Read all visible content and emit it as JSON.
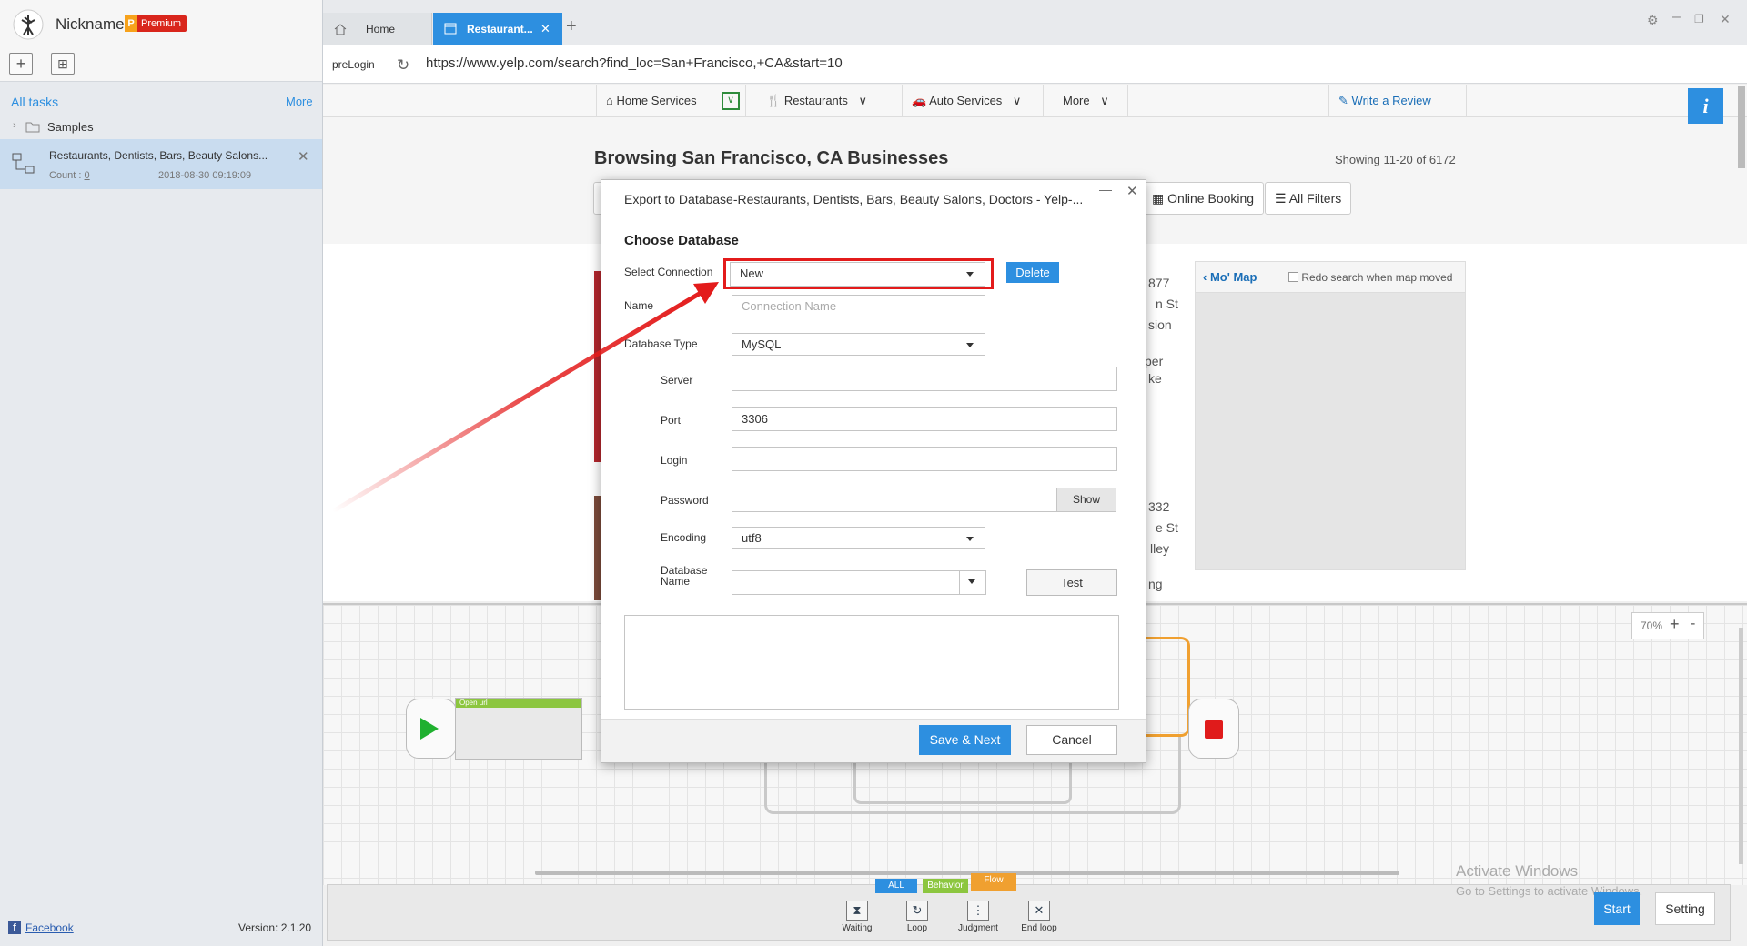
{
  "app": {
    "nickname": "Nickname",
    "premium": "Premium",
    "version": "Version: 2.1.20",
    "facebook": "Facebook"
  },
  "sidebar": {
    "all_tasks": "All tasks",
    "more": "More",
    "samples": "Samples",
    "task": {
      "name": "Restaurants, Dentists, Bars, Beauty Salons...",
      "count_label": "Count :",
      "count": "0",
      "date": "2018-08-30 09:19:09"
    }
  },
  "tabs": [
    {
      "label": "Home"
    },
    {
      "label": "Restaurant..."
    }
  ],
  "browser": {
    "prelogin": "preLogin",
    "url": "https://www.yelp.com/search?find_loc=San+Francisco,+CA&start=10"
  },
  "yelp": {
    "nav": [
      "Home Services",
      "Restaurants",
      "Auto Services",
      "More"
    ],
    "write_review": "Write a Review",
    "heading": "Browsing San Francisco, CA Businesses",
    "showing": "Showing 11-20 of 6172",
    "filters": [
      "Online Booking",
      "All Filters"
    ],
    "map_title": "Mo' Map",
    "redo": "Redo search when map moved",
    "peek": [
      "877",
      "n St",
      "sion",
      "per",
      "ke",
      "332",
      "e St",
      "lley",
      "ng"
    ]
  },
  "modal": {
    "title": "Export to Database-Restaurants, Dentists, Bars, Beauty Salons, Doctors - Yelp-...",
    "heading": "Choose Database",
    "select_connection_label": "Select Connection",
    "select_connection_value": "New",
    "delete": "Delete",
    "name_label": "Name",
    "name_placeholder": "Connection Name",
    "db_type_label": "Database Type",
    "db_type_value": "MySQL",
    "server_label": "Server",
    "port_label": "Port",
    "port_value": "3306",
    "login_label": "Login",
    "password_label": "Password",
    "show": "Show",
    "encoding_label": "Encoding",
    "encoding_value": "utf8",
    "dbname_label": "Database Name",
    "test": "Test",
    "save_next": "Save & Next",
    "cancel": "Cancel"
  },
  "workflow": {
    "zoom": "70%",
    "open_url": "Open url",
    "categories": [
      "ALL",
      "Behavior",
      "Flow"
    ],
    "tools": [
      "Waiting",
      "Loop",
      "Judgment",
      "End loop"
    ],
    "start": "Start",
    "setting": "Setting"
  },
  "watermark": {
    "line1": "Activate Windows",
    "line2": "Go to Settings to activate Windows."
  },
  "colors": {
    "accent": "#2d8fe0",
    "highlight": "#e31b1b",
    "premium": "#d9261c"
  }
}
